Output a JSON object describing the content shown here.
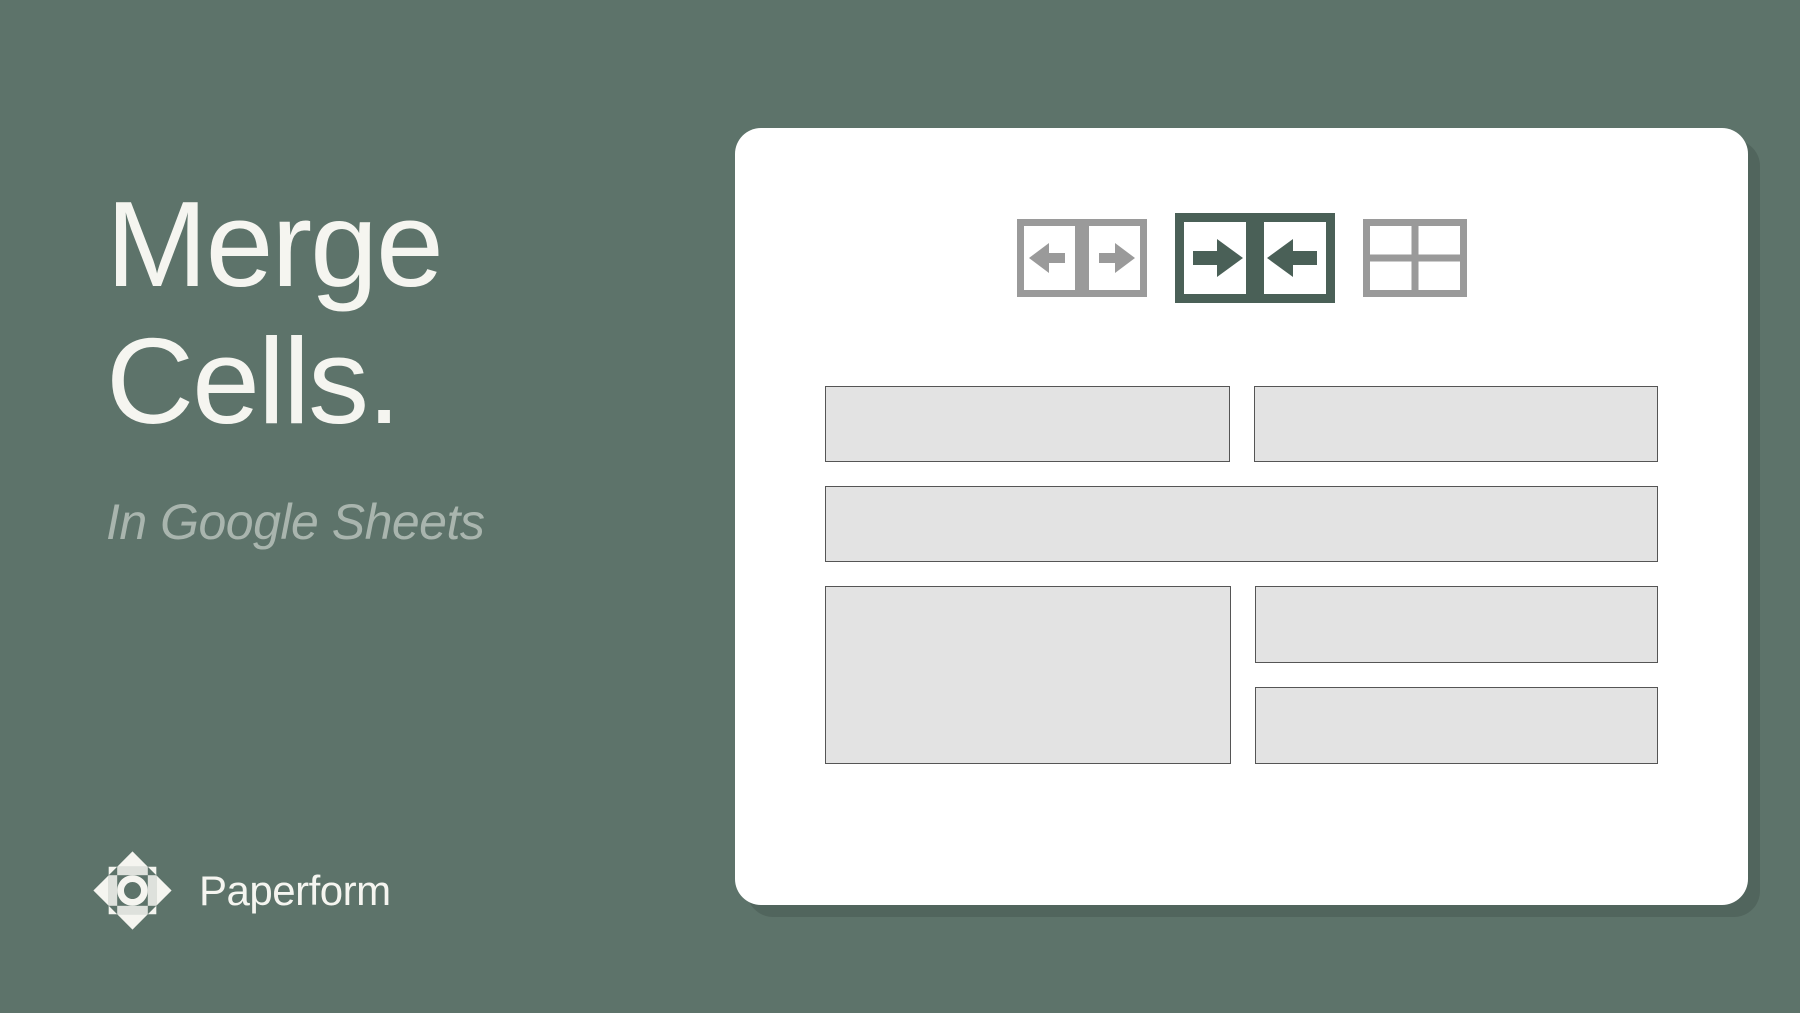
{
  "heading": {
    "title_line1": "Merge",
    "title_line2": "Cells.",
    "subtitle": "In Google Sheets"
  },
  "brand": {
    "name": "Paperform"
  },
  "icons": {
    "expand": "expand-horizontal-icon",
    "merge": "merge-horizontal-icon",
    "grid": "grid-cells-icon"
  },
  "colors": {
    "background": "#5d736a",
    "text_light": "#f5f5f0",
    "text_muted": "#a9b5ae",
    "panel": "#ffffff",
    "cell_fill": "#e3e3e3",
    "icon_muted": "#9a9a9a",
    "icon_active": "#4a6057"
  }
}
